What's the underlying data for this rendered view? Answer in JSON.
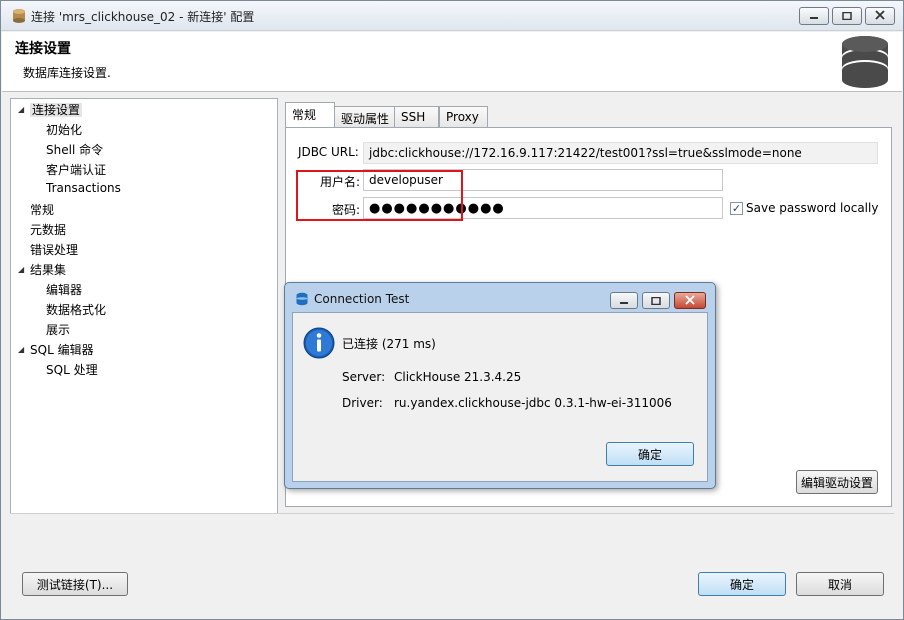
{
  "window": {
    "title": "连接 'mrs_clickhouse_02 - 新连接' 配置",
    "header_title": "连接设置",
    "header_subtitle": "数据库连接设置."
  },
  "tree": {
    "items": [
      {
        "label": "连接设置",
        "level": 0,
        "expanded": true,
        "selected": true
      },
      {
        "label": "初始化",
        "level": 1
      },
      {
        "label": "Shell 命令",
        "level": 1
      },
      {
        "label": "客户端认证",
        "level": 1
      },
      {
        "label": "Transactions",
        "level": 1
      },
      {
        "label": "常规",
        "level": 0
      },
      {
        "label": "元数据",
        "level": 0
      },
      {
        "label": "错误处理",
        "level": 0
      },
      {
        "label": "结果集",
        "level": 0,
        "expanded": true
      },
      {
        "label": "编辑器",
        "level": 1
      },
      {
        "label": "数据格式化",
        "level": 1
      },
      {
        "label": "展示",
        "level": 1
      },
      {
        "label": "SQL 编辑器",
        "level": 0,
        "expanded": true
      },
      {
        "label": "SQL 处理",
        "level": 1
      }
    ]
  },
  "tabs": [
    "常规",
    "驱动属性",
    "SSH",
    "Proxy"
  ],
  "form": {
    "jdbc_label": "JDBC URL:",
    "jdbc_value": "jdbc:clickhouse://172.16.9.117:21422/test001?ssl=true&sslmode=none",
    "user_label": "用户名:",
    "user_value": "developuser",
    "password_label": "密码:",
    "password_value": "●●●●●●●●●●●",
    "save_password_label": "Save password locally",
    "save_password_checked": true,
    "edit_driver_button": "编辑驱动设置"
  },
  "footer": {
    "test_button": "测试链接(T)...",
    "ok_button": "确定",
    "cancel_button": "取消"
  },
  "dialog": {
    "title": "Connection Test",
    "message": "已连接 (271 ms)",
    "server_label": "Server:",
    "server_value": "ClickHouse 21.3.4.25",
    "driver_label": "Driver:",
    "driver_value": "ru.yandex.clickhouse-jdbc 0.3.1-hw-ei-311006",
    "ok_button": "确定"
  },
  "colors": {
    "highlight_box": "#e0151b",
    "dialog_frame": "#b9d1ea",
    "info_icon": "#1b5fb4"
  }
}
